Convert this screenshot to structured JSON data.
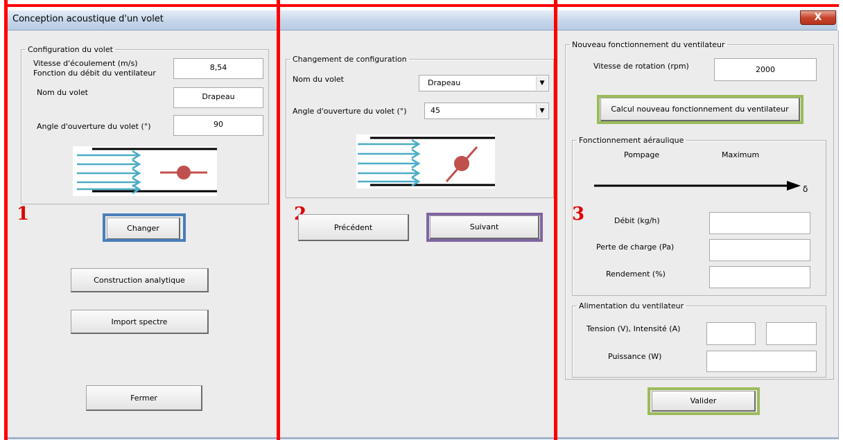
{
  "window": {
    "title": "Conception acoustique d'un volet",
    "close_label": "X"
  },
  "panel1": {
    "number": "1",
    "legend": "Configuration du volet",
    "speed_label_1": "Vitesse d'écoulement (m/s)",
    "speed_label_2": "Fonction du débit du ventilateur",
    "speed_value": "8,54",
    "name_label": "Nom du volet",
    "name_value": "Drapeau",
    "angle_label": "Angle d'ouverture du volet (°)",
    "angle_value": "90",
    "change_button": "Changer",
    "construction_button": "Construction analytique",
    "import_button": "Import spectre",
    "close_button": "Fermer"
  },
  "panel2": {
    "number": "2",
    "legend": "Changement de configuration",
    "name_label": "Nom du volet",
    "name_selected": "Drapeau",
    "angle_label": "Angle d'ouverture du volet (°)",
    "angle_selected": "45",
    "previous_button": "Précédent",
    "next_button": "Suivant"
  },
  "panel3": {
    "number": "3",
    "legend": "Nouveau fonctionnement du ventilateur",
    "rotation_label": "Vitesse de rotation (rpm)",
    "rotation_value": "2000",
    "calc_button": "Calcul nouveau fonctionnement du ventilateur",
    "aero_legend": "Fonctionnement aéraulique",
    "pumping_label": "Pompage",
    "maximum_label": "Maximum",
    "delta_symbol": "δ",
    "flow_label": "Débit (kg/h)",
    "flow_value": "",
    "pressure_label": "Perte de charge (Pa)",
    "pressure_value": "",
    "efficiency_label": "Rendement (%)",
    "efficiency_value": "",
    "supply_legend": "Alimentation du ventilateur",
    "voltage_label": "Tension (V), Intensité (A)",
    "voltage_value": "",
    "current_value": "",
    "power_label": "Puissance (W)",
    "power_value": "",
    "validate_button": "Valider"
  },
  "colors": {
    "red_divider": "#ff0000",
    "blue_highlight": "#4a7ebb",
    "purple_highlight": "#8064a2",
    "green_highlight": "#9bbb59",
    "flow_arrow": "#4bacc6",
    "damper": "#c0504d"
  }
}
